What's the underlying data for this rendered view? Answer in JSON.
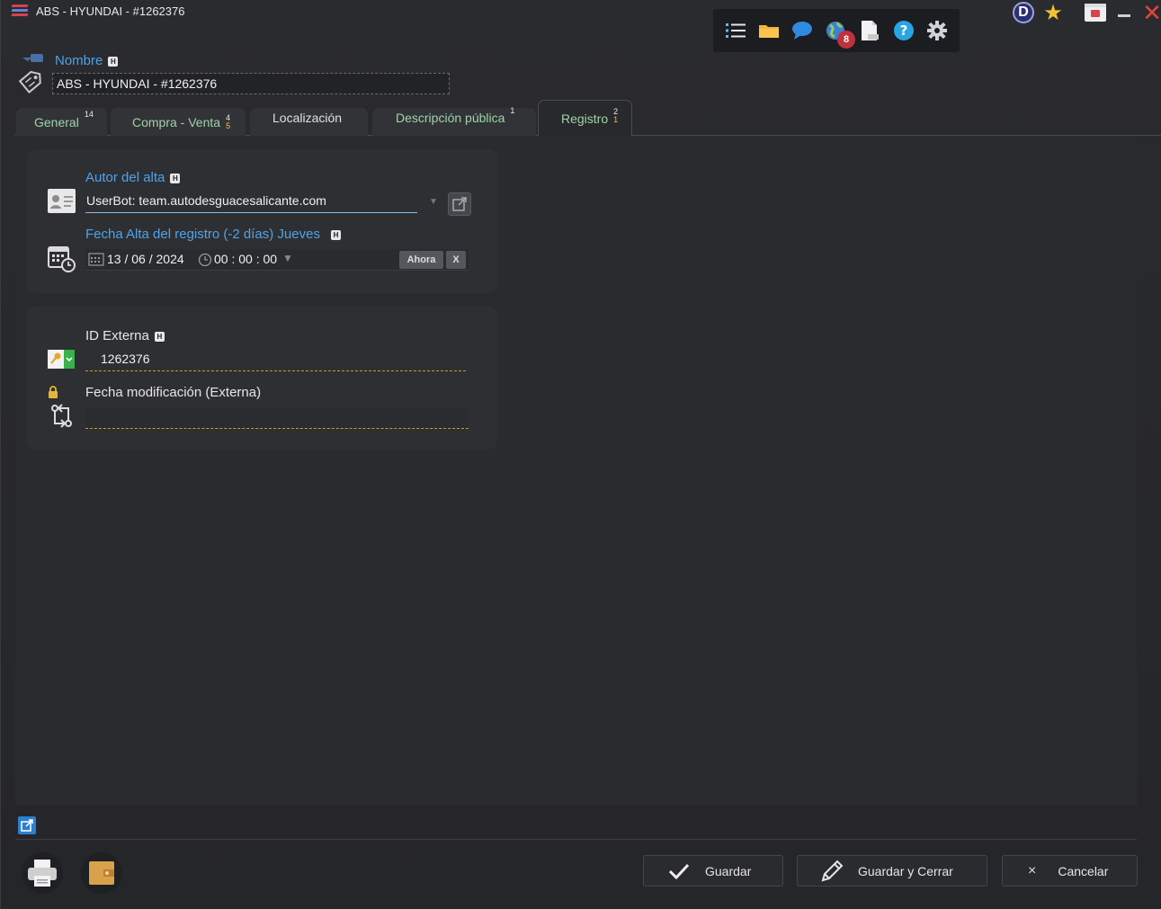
{
  "window": {
    "title": "ABS - HYUNDAI - #1262376",
    "avatar_letter": "D",
    "notification_count": "8"
  },
  "header": {
    "name_label": "Nombre",
    "name_value": "ABS - HYUNDAI - #1262376",
    "help_chip": "H"
  },
  "tabs": [
    {
      "label": "General",
      "count_top": "14",
      "count_bottom": ""
    },
    {
      "label": "Compra - Venta",
      "count_top": "4",
      "count_bottom": "5"
    },
    {
      "label": "Localización",
      "count_top": "",
      "count_bottom": ""
    },
    {
      "label": "Descripción pública",
      "count_top": "1",
      "count_bottom": ""
    },
    {
      "label": "Registro",
      "count_top": "2",
      "count_bottom": "1"
    }
  ],
  "registro": {
    "autor_label": "Autor del alta",
    "autor_value": "UserBot: team.autodesguacesalicante.com",
    "fecha_label": "Fecha Alta del registro (-2 días) Jueves",
    "fecha_day": "13",
    "fecha_month": "06",
    "fecha_year": "2024",
    "fecha_time": "00 : 00 : 00",
    "ahora_label": "Ahora",
    "clear_label": "X",
    "id_externa_label": "ID Externa",
    "id_externa_value": "1262376",
    "fecha_mod_label": "Fecha modificación (Externa)",
    "fecha_mod_value": ""
  },
  "footer": {
    "guardar": "Guardar",
    "guardar_cerrar": "Guardar y Cerrar",
    "cancelar": "Cancelar"
  },
  "colors": {
    "accent_blue": "#4fa3e8",
    "tab_green": "#9fd3a8",
    "gold": "#c99a2e",
    "close_red": "#e0443e"
  }
}
